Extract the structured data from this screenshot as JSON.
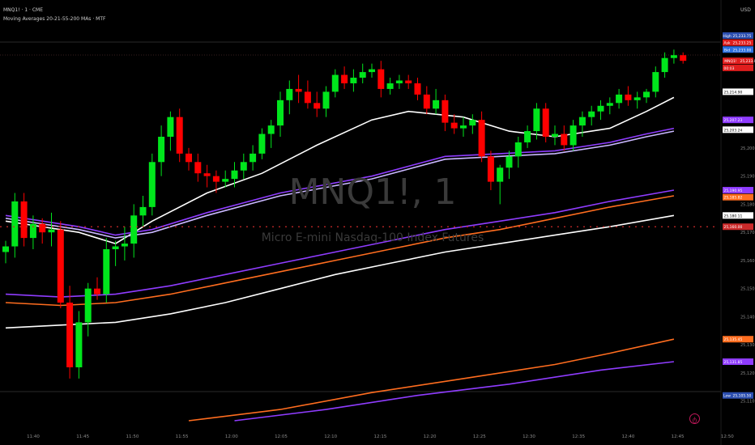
{
  "header": {
    "symbol_line": "MNQ1! · 1 · CME",
    "study_line": "Moving Averages 20-21-55-200 MAs · MTF"
  },
  "watermark": {
    "symbol": "MNQ1!, 1",
    "description": "Micro E-mini Nasdaq-100 Index Futures"
  },
  "currency": "USD",
  "logo_glyph": "ტ",
  "colors": {
    "background": "#000000",
    "bull": "#00e61c",
    "bear": "#ff0000",
    "ma_white": "#ffffff",
    "ma_violet": "#8f3cff",
    "ma_orange": "#ff6d1f",
    "ma_lavender": "#cab8ff"
  },
  "chart_data": {
    "type": "candlestick",
    "y_range": [
      25103,
      25244
    ],
    "x_ticks": [
      "11:40",
      "11:45",
      "11:50",
      "11:55",
      "12:00",
      "12:05",
      "12:10",
      "12:15",
      "12:20",
      "12:25",
      "12:30",
      "12:35",
      "12:40",
      "12:45",
      "12:50"
    ],
    "y_ticks": [
      "25,200.00",
      "25,190.00",
      "25,180.00",
      "25,170.00",
      "25,160.00",
      "25,150.00",
      "25,140.00",
      "25,130.00",
      "25,120.00",
      "25,110.00"
    ],
    "candles": [
      {
        "o": 25163.0,
        "h": 25167.0,
        "l": 25159.0,
        "c": 25165.0
      },
      {
        "o": 25165.0,
        "h": 25184.0,
        "l": 25161.0,
        "c": 25181.0
      },
      {
        "o": 25181.0,
        "h": 25184.0,
        "l": 25165.0,
        "c": 25168.0
      },
      {
        "o": 25168.0,
        "h": 25176.0,
        "l": 25164.0,
        "c": 25173.0
      },
      {
        "o": 25173.0,
        "h": 25175.0,
        "l": 25166.0,
        "c": 25170.0
      },
      {
        "o": 25170.0,
        "h": 25177.0,
        "l": 25165.0,
        "c": 25171.0
      },
      {
        "o": 25171.0,
        "h": 25174.0,
        "l": 25143.0,
        "c": 25145.0
      },
      {
        "o": 25145.0,
        "h": 25151.0,
        "l": 25118.0,
        "c": 25122.0
      },
      {
        "o": 25122.0,
        "h": 25142.0,
        "l": 25118.0,
        "c": 25138.0
      },
      {
        "o": 25138.0,
        "h": 25152.0,
        "l": 25133.0,
        "c": 25150.0
      },
      {
        "o": 25150.0,
        "h": 25154.0,
        "l": 25146.0,
        "c": 25148.0
      },
      {
        "o": 25148.0,
        "h": 25168.0,
        "l": 25145.0,
        "c": 25164.0
      },
      {
        "o": 25164.0,
        "h": 25167.0,
        "l": 25158.0,
        "c": 25165.0
      },
      {
        "o": 25165.0,
        "h": 25172.0,
        "l": 25160.0,
        "c": 25166.0
      },
      {
        "o": 25166.0,
        "h": 25180.0,
        "l": 25161.0,
        "c": 25176.0
      },
      {
        "o": 25176.0,
        "h": 25183.0,
        "l": 25172.0,
        "c": 25179.0
      },
      {
        "o": 25179.0,
        "h": 25198.0,
        "l": 25176.0,
        "c": 25195.0
      },
      {
        "o": 25195.0,
        "h": 25208.0,
        "l": 25190.0,
        "c": 25204.0
      },
      {
        "o": 25204.0,
        "h": 25213.0,
        "l": 25199.0,
        "c": 25211.0
      },
      {
        "o": 25211.0,
        "h": 25214.0,
        "l": 25195.0,
        "c": 25198.0
      },
      {
        "o": 25198.0,
        "h": 25200.0,
        "l": 25192.0,
        "c": 25195.0
      },
      {
        "o": 25195.0,
        "h": 25198.0,
        "l": 25188.0,
        "c": 25191.0
      },
      {
        "o": 25191.0,
        "h": 25194.0,
        "l": 25186.0,
        "c": 25190.0
      },
      {
        "o": 25190.0,
        "h": 25192.0,
        "l": 25184.0,
        "c": 25188.0
      },
      {
        "o": 25188.0,
        "h": 25192.0,
        "l": 25186.0,
        "c": 25189.0
      },
      {
        "o": 25189.0,
        "h": 25195.0,
        "l": 25186.0,
        "c": 25192.0
      },
      {
        "o": 25192.0,
        "h": 25198.0,
        "l": 25189.0,
        "c": 25195.0
      },
      {
        "o": 25195.0,
        "h": 25201.0,
        "l": 25192.0,
        "c": 25198.0
      },
      {
        "o": 25198.0,
        "h": 25207.0,
        "l": 25196.0,
        "c": 25205.0
      },
      {
        "o": 25205.0,
        "h": 25210.0,
        "l": 25200.0,
        "c": 25208.0
      },
      {
        "o": 25208.0,
        "h": 25220.0,
        "l": 25204.0,
        "c": 25217.0
      },
      {
        "o": 25217.0,
        "h": 25224.0,
        "l": 25212.0,
        "c": 25221.0
      },
      {
        "o": 25221.0,
        "h": 25226.0,
        "l": 25216.0,
        "c": 25220.0
      },
      {
        "o": 25220.0,
        "h": 25224.0,
        "l": 25214.0,
        "c": 25216.0
      },
      {
        "o": 25216.0,
        "h": 25220.0,
        "l": 25211.0,
        "c": 25214.0
      },
      {
        "o": 25214.0,
        "h": 25222.0,
        "l": 25211.0,
        "c": 25220.0
      },
      {
        "o": 25220.0,
        "h": 25228.0,
        "l": 25218.0,
        "c": 25226.0
      },
      {
        "o": 25226.0,
        "h": 25229.0,
        "l": 25221.0,
        "c": 25223.0
      },
      {
        "o": 25223.0,
        "h": 25228.0,
        "l": 25220.0,
        "c": 25225.0
      },
      {
        "o": 25225.0,
        "h": 25230.0,
        "l": 25223.0,
        "c": 25227.0
      },
      {
        "o": 25227.0,
        "h": 25230.0,
        "l": 25225.0,
        "c": 25228.0
      },
      {
        "o": 25228.0,
        "h": 25231.0,
        "l": 25218.0,
        "c": 25221.0
      },
      {
        "o": 25221.0,
        "h": 25225.0,
        "l": 25219.0,
        "c": 25223.0
      },
      {
        "o": 25223.0,
        "h": 25226.0,
        "l": 25221.0,
        "c": 25224.0
      },
      {
        "o": 25224.0,
        "h": 25226.0,
        "l": 25221.0,
        "c": 25223.0
      },
      {
        "o": 25223.0,
        "h": 25225.0,
        "l": 25217.0,
        "c": 25219.0
      },
      {
        "o": 25219.0,
        "h": 25222.0,
        "l": 25212.0,
        "c": 25214.0
      },
      {
        "o": 25214.0,
        "h": 25221.0,
        "l": 25212.0,
        "c": 25217.0
      },
      {
        "o": 25217.0,
        "h": 25219.0,
        "l": 25206.0,
        "c": 25209.0
      },
      {
        "o": 25209.0,
        "h": 25212.0,
        "l": 25205.0,
        "c": 25207.0
      },
      {
        "o": 25207.0,
        "h": 25211.0,
        "l": 25204.0,
        "c": 25208.0
      },
      {
        "o": 25208.0,
        "h": 25212.0,
        "l": 25205.0,
        "c": 25210.0
      },
      {
        "o": 25210.0,
        "h": 25213.0,
        "l": 25195.0,
        "c": 25197.0
      },
      {
        "o": 25197.0,
        "h": 25199.0,
        "l": 25185.0,
        "c": 25188.0
      },
      {
        "o": 25188.0,
        "h": 25194.0,
        "l": 25180.0,
        "c": 25193.0
      },
      {
        "o": 25193.0,
        "h": 25199.0,
        "l": 25189.0,
        "c": 25197.0
      },
      {
        "o": 25197.0,
        "h": 25204.0,
        "l": 25193.0,
        "c": 25202.0
      },
      {
        "o": 25202.0,
        "h": 25208.0,
        "l": 25200.0,
        "c": 25206.0
      },
      {
        "o": 25206.0,
        "h": 25216.0,
        "l": 25203.0,
        "c": 25214.0
      },
      {
        "o": 25214.0,
        "h": 25216.0,
        "l": 25202.0,
        "c": 25204.0
      },
      {
        "o": 25204.0,
        "h": 25208.0,
        "l": 25201.0,
        "c": 25205.0
      },
      {
        "o": 25205.0,
        "h": 25208.0,
        "l": 25199.0,
        "c": 25201.0
      },
      {
        "o": 25201.0,
        "h": 25210.0,
        "l": 25199.0,
        "c": 25208.0
      },
      {
        "o": 25208.0,
        "h": 25213.0,
        "l": 25204.0,
        "c": 25211.0
      },
      {
        "o": 25211.0,
        "h": 25215.0,
        "l": 25208.0,
        "c": 25213.0
      },
      {
        "o": 25213.0,
        "h": 25217.0,
        "l": 25210.0,
        "c": 25215.0
      },
      {
        "o": 25215.0,
        "h": 25218.0,
        "l": 25212.0,
        "c": 25216.0
      },
      {
        "o": 25216.0,
        "h": 25221.0,
        "l": 25214.0,
        "c": 25219.0
      },
      {
        "o": 25219.0,
        "h": 25222.0,
        "l": 25215.0,
        "c": 25217.0
      },
      {
        "o": 25217.0,
        "h": 25220.0,
        "l": 25214.0,
        "c": 25218.0
      },
      {
        "o": 25218.0,
        "h": 25221.0,
        "l": 25216.0,
        "c": 25220.0
      },
      {
        "o": 25220.0,
        "h": 25229.0,
        "l": 25218.0,
        "c": 25227.0
      },
      {
        "o": 25227.0,
        "h": 25234.0,
        "l": 25225.0,
        "c": 25232.0
      },
      {
        "o": 25232.0,
        "h": 25235.0,
        "l": 25230.0,
        "c": 25233.0
      },
      {
        "o": 25233.0,
        "h": 25234.0,
        "l": 25230.0,
        "c": 25231.0
      }
    ],
    "moving_averages": [
      {
        "color": "#ffffff",
        "points": [
          [
            0,
            25174
          ],
          [
            8,
            25170
          ],
          [
            12,
            25166
          ],
          [
            16,
            25174
          ],
          [
            22,
            25184
          ],
          [
            28,
            25191
          ],
          [
            34,
            25201
          ],
          [
            40,
            25210
          ],
          [
            44,
            25213
          ],
          [
            50,
            25211
          ],
          [
            55,
            25206
          ],
          [
            60,
            25204
          ],
          [
            66,
            25207
          ],
          [
            70,
            25213
          ],
          [
            73,
            25218
          ]
        ]
      },
      {
        "color": "#cab8ff",
        "points": [
          [
            0,
            25175
          ],
          [
            8,
            25171
          ],
          [
            12,
            25168
          ],
          [
            16,
            25170
          ],
          [
            22,
            25176
          ],
          [
            30,
            25183
          ],
          [
            40,
            25189
          ],
          [
            48,
            25196
          ],
          [
            54,
            25197
          ],
          [
            60,
            25198
          ],
          [
            66,
            25201
          ],
          [
            70,
            25204
          ],
          [
            73,
            25206
          ]
        ]
      },
      {
        "color": "#8f3cff",
        "points": [
          [
            0,
            25176
          ],
          [
            8,
            25172
          ],
          [
            12,
            25169
          ],
          [
            16,
            25171
          ],
          [
            22,
            25177
          ],
          [
            30,
            25184
          ],
          [
            40,
            25190
          ],
          [
            48,
            25197
          ],
          [
            54,
            25198
          ],
          [
            60,
            25199
          ],
          [
            66,
            25202
          ],
          [
            70,
            25205
          ],
          [
            73,
            25207
          ]
        ]
      },
      {
        "color": "#8f3cff",
        "points": [
          [
            0,
            25148
          ],
          [
            6,
            25147
          ],
          [
            12,
            25148
          ],
          [
            18,
            25151
          ],
          [
            24,
            25155
          ],
          [
            30,
            25159
          ],
          [
            36,
            25163
          ],
          [
            42,
            25167
          ],
          [
            48,
            25171
          ],
          [
            54,
            25174
          ],
          [
            60,
            25177
          ],
          [
            66,
            25181
          ],
          [
            73,
            25185
          ]
        ]
      },
      {
        "color": "#ff6d1f",
        "points": [
          [
            0,
            25145
          ],
          [
            6,
            25144
          ],
          [
            12,
            25145
          ],
          [
            18,
            25148
          ],
          [
            24,
            25152
          ],
          [
            30,
            25156
          ],
          [
            36,
            25160
          ],
          [
            42,
            25164
          ],
          [
            48,
            25168
          ],
          [
            54,
            25171
          ],
          [
            60,
            25175
          ],
          [
            66,
            25179
          ],
          [
            73,
            25183
          ]
        ]
      },
      {
        "color": "#ffffff",
        "points": [
          [
            0,
            25136
          ],
          [
            6,
            25137
          ],
          [
            12,
            25138
          ],
          [
            18,
            25141
          ],
          [
            24,
            25145
          ],
          [
            30,
            25150
          ],
          [
            36,
            25155
          ],
          [
            42,
            25159
          ],
          [
            48,
            25163
          ],
          [
            54,
            25166
          ],
          [
            60,
            25169
          ],
          [
            66,
            25172
          ],
          [
            73,
            25176
          ]
        ]
      },
      {
        "color": "#ff6d1f",
        "points": [
          [
            20,
            25103
          ],
          [
            30,
            25107
          ],
          [
            40,
            25113
          ],
          [
            50,
            25118
          ],
          [
            60,
            25123
          ],
          [
            66,
            25127
          ],
          [
            73,
            25132
          ]
        ]
      },
      {
        "color": "#8f3cff",
        "points": [
          [
            25,
            25103
          ],
          [
            35,
            25107
          ],
          [
            45,
            25112
          ],
          [
            55,
            25116
          ],
          [
            65,
            25121
          ],
          [
            73,
            25124
          ]
        ]
      }
    ],
    "reference_line": {
      "price": 25172.0,
      "color": "#cc2a2a",
      "style": "dotted"
    },
    "price_labels": [
      {
        "text": "High",
        "value": "25,233.75",
        "y": 25240.0,
        "color": "#2b4eaf"
      },
      {
        "text": "Ask",
        "value": "25,233.25",
        "y": 25237.5,
        "color": "#e01e1e"
      },
      {
        "text": "Bid",
        "value": "25,233.00",
        "y": 25235.0,
        "color": "#2b6fe0"
      },
      {
        "text": "MNQ1!",
        "value": "25,233.00",
        "y": 25231.0,
        "color": "#e01e1e"
      },
      {
        "text": "",
        "value": "00:03",
        "y": 25228.5,
        "color": "#e01e1e"
      },
      {
        "text": "",
        "value": "25,214.90",
        "y": 25220.0,
        "color": "#ffffff"
      },
      {
        "text": "",
        "value": "25,207.23",
        "y": 25210.0,
        "color": "#8f3cff"
      },
      {
        "text": "",
        "value": "25,203.24",
        "y": 25206.5,
        "color": "#ffffff"
      },
      {
        "text": "",
        "value": "25,190.95",
        "y": 25185.0,
        "color": "#8f3cff"
      },
      {
        "text": "",
        "value": "25,185.82",
        "y": 25182.5,
        "color": "#ff6d1f"
      },
      {
        "text": "",
        "value": "25,180.11",
        "y": 25176.0,
        "color": "#ffffff"
      },
      {
        "text": "",
        "value": "25,160.00",
        "y": 25172.0,
        "color": "#cc2a2a"
      },
      {
        "text": "",
        "value": "25,135.45",
        "y": 25132.0,
        "color": "#ff6d1f"
      },
      {
        "text": "",
        "value": "25,131.85",
        "y": 25124.0,
        "color": "#8f3cff"
      },
      {
        "text": "Low",
        "value": "25,105.50",
        "y": 25112.0,
        "color": "#2b4eaf"
      }
    ]
  }
}
